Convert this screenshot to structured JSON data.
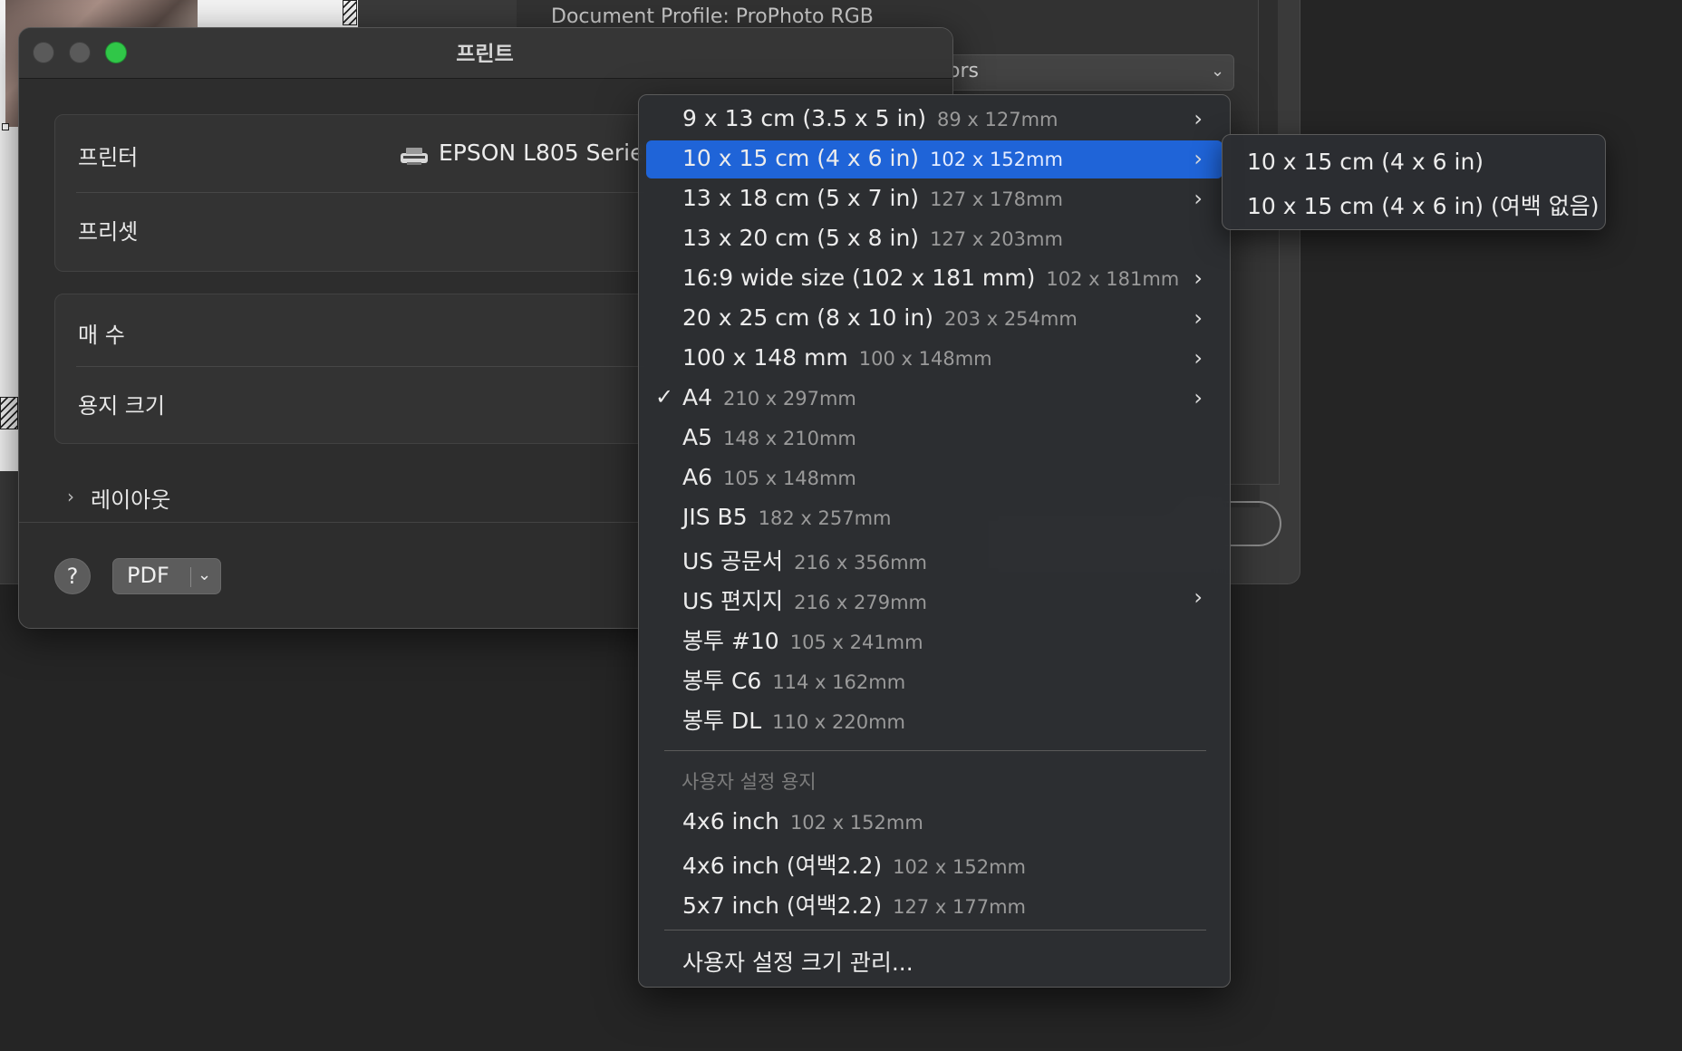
{
  "background_app": {
    "document_profile": "Document Profile: ProPhoto RGB",
    "select_partial_text": "ors"
  },
  "dialog": {
    "title": "프린트",
    "printer_label": "프린터",
    "printer_name": "EPSON L805 Serie",
    "preset_label": "프리셋",
    "copies_label": "매 수",
    "paper_size_label": "용지 크기",
    "layout_label": "레이아웃",
    "help_label": "?",
    "pdf_label": "PDF"
  },
  "paper_menu": {
    "items": [
      {
        "label": "9 x 13 cm (3.5 x 5 in)",
        "dim": "89 x 127mm",
        "submenu": true,
        "checked": false,
        "highlighted": false
      },
      {
        "label": "10 x 15 cm (4 x 6 in)",
        "dim": "102 x 152mm",
        "submenu": true,
        "checked": false,
        "highlighted": true
      },
      {
        "label": "13 x 18 cm (5 x 7 in)",
        "dim": "127 x 178mm",
        "submenu": true,
        "checked": false,
        "highlighted": false
      },
      {
        "label": "13 x 20 cm (5 x 8 in)",
        "dim": "127 x 203mm",
        "submenu": false,
        "checked": false,
        "highlighted": false
      },
      {
        "label": "16:9 wide size (102 x 181 mm)",
        "dim": "102 x 181mm",
        "submenu": true,
        "checked": false,
        "highlighted": false
      },
      {
        "label": "20 x 25 cm (8 x 10 in)",
        "dim": "203 x 254mm",
        "submenu": true,
        "checked": false,
        "highlighted": false
      },
      {
        "label": "100 x 148 mm",
        "dim": "100 x 148mm",
        "submenu": true,
        "checked": false,
        "highlighted": false
      },
      {
        "label": "A4",
        "dim": "210 x 297mm",
        "submenu": true,
        "checked": true,
        "highlighted": false
      },
      {
        "label": "A5",
        "dim": "148 x 210mm",
        "submenu": false,
        "checked": false,
        "highlighted": false
      },
      {
        "label": "A6",
        "dim": "105 x 148mm",
        "submenu": false,
        "checked": false,
        "highlighted": false
      },
      {
        "label": "JIS B5",
        "dim": "182 x 257mm",
        "submenu": false,
        "checked": false,
        "highlighted": false
      },
      {
        "label": "US 공문서",
        "dim": "216 x 356mm",
        "submenu": false,
        "checked": false,
        "highlighted": false
      },
      {
        "label": "US 편지지",
        "dim": "216 x 279mm",
        "submenu": true,
        "checked": false,
        "highlighted": false
      },
      {
        "label": "봉투 #10",
        "dim": "105 x 241mm",
        "submenu": false,
        "checked": false,
        "highlighted": false
      },
      {
        "label": "봉투 C6",
        "dim": "114 x 162mm",
        "submenu": false,
        "checked": false,
        "highlighted": false
      },
      {
        "label": "봉투 DL",
        "dim": "110 x 220mm",
        "submenu": false,
        "checked": false,
        "highlighted": false
      }
    ],
    "custom_section_header": "사용자 설정 용지",
    "custom_items": [
      {
        "label": "4x6 inch",
        "dim": "102 x 152mm"
      },
      {
        "label": "4x6 inch (여백2.2)",
        "dim": "102 x 152mm"
      },
      {
        "label": "5x7 inch (여백2.2)",
        "dim": "127 x 177mm"
      }
    ],
    "manage_label": "사용자 설정 크기 관리..."
  },
  "submenu": {
    "items": [
      "10 x 15 cm (4 x 6 in)",
      "10 x 15 cm (4 x 6 in) (여백 없음)"
    ]
  },
  "icons": {
    "submenu_arrow": "›",
    "checkmark": "✓",
    "disclosure": "›",
    "dropdown": "⌄"
  },
  "colors": {
    "highlight": "#1f64d8",
    "zoom_button": "#30c748"
  }
}
